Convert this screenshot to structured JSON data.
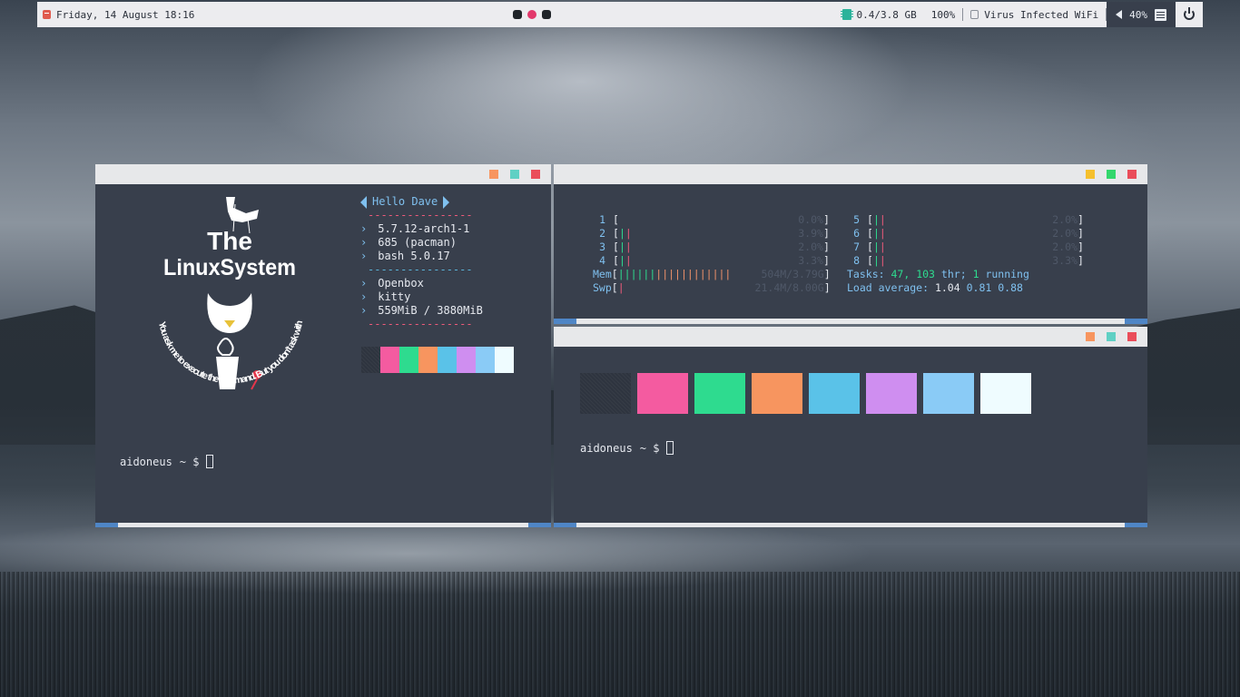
{
  "topbar": {
    "date": "Friday, 14 August 18:16",
    "memory": "0.4/3.8 GB",
    "cpu_pct": "100%",
    "wifi": "Virus Infected WiFi",
    "volume": "40%"
  },
  "colors": {
    "bg": "#383f4c",
    "titlebar": "#e7e8ea",
    "btn_orange": "#f7955f",
    "btn_teal": "#5fd0c4",
    "btn_red": "#ea4d5a",
    "btn_yellow": "#f5c02e",
    "btn_green": "#33d76c",
    "accent_blue": "#4f86c6"
  },
  "fetch_window": {
    "logo": {
      "title_line1": "The",
      "title_line2": "LinuxSystem",
      "tagline": "You ask me to execute the command. But you don't ask with sudo."
    },
    "greeting": "Hello Dave",
    "dash_red": "----------------",
    "dash_blue": "----------------",
    "group1": [
      "5.7.12-arch1-1",
      "685 (pacman)",
      "bash 5.0.17"
    ],
    "group2": [
      "Openbox",
      "kitty",
      "559MiB / 3880MiB"
    ],
    "chevron": "›",
    "palette": [
      "#2e343f",
      "#f45ba0",
      "#2edb8f",
      "#f7955f",
      "#5ac2e8",
      "#cf8ef0",
      "#8acbf6",
      "#effcff"
    ],
    "prompt_user": "aidoneus",
    "prompt_rest": "~ $"
  },
  "htop_window": {
    "cpus_left": [
      {
        "n": "1",
        "bars": "",
        "pct": "0.0%"
      },
      {
        "n": "2",
        "bars": "||",
        "pct": "3.9%"
      },
      {
        "n": "3",
        "bars": "||",
        "pct": "2.0%"
      },
      {
        "n": "4",
        "bars": "||",
        "pct": "3.3%"
      }
    ],
    "cpus_right": [
      {
        "n": "5",
        "bars": "||",
        "pct": "2.0%"
      },
      {
        "n": "6",
        "bars": "||",
        "pct": "2.0%"
      },
      {
        "n": "7",
        "bars": "||",
        "pct": "2.0%"
      },
      {
        "n": "8",
        "bars": "||",
        "pct": "3.3%"
      }
    ],
    "mem_label": "Mem",
    "mem_bars_green": "||||||",
    "mem_bars_orange": "||||||||||||",
    "mem_value": "504M/3.79G",
    "swp_label": "Swp",
    "swp_bars": "|",
    "swp_value": "21.4M/8.00G",
    "tasks_label": "Tasks:",
    "tasks_count": "47,",
    "threads": "103",
    "thr_label": "thr;",
    "running_count": "1",
    "running_label": "running",
    "load_label": "Load average:",
    "load1": "1.04",
    "load5": "0.81",
    "load15": "0.88"
  },
  "colors_window": {
    "palette": [
      "#2e343f",
      "#f45ba0",
      "#2edb8f",
      "#f7955f",
      "#5ac2e8",
      "#cf8ef0",
      "#8acbf6",
      "#effcff"
    ],
    "prompt_user": "aidoneus",
    "prompt_rest": "~ $"
  }
}
